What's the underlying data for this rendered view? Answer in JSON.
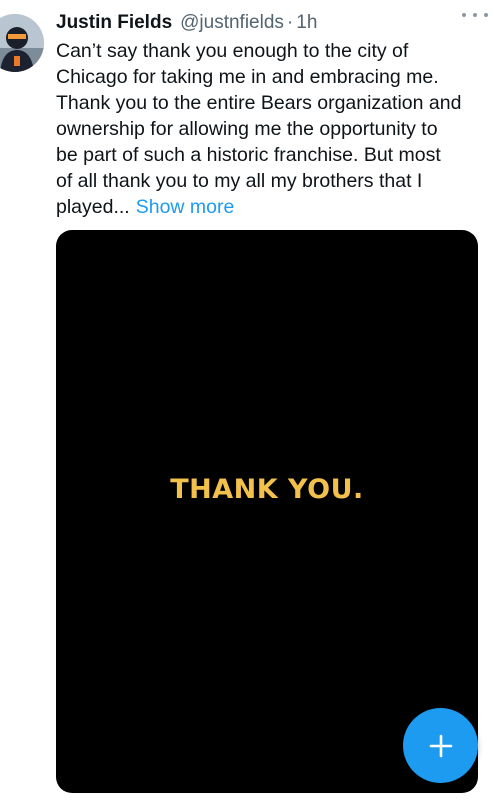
{
  "tweet": {
    "author_name": "Justin Fields",
    "handle": "@justnfields",
    "separator": "·",
    "time": "1h",
    "text_lines": [
      "Can’t say thank you enough to the city of",
      "Chicago for taking me in and embracing me.",
      "Thank you to the entire Bears organization and",
      "ownership for allowing me the opportunity to",
      "be part of such a historic franchise. But most",
      "of all thank you to my all my brothers that I",
      "played..."
    ],
    "show_more": "Show more",
    "media_text": "THANK YOU."
  },
  "icons": {
    "more": "more-horizontal-icon",
    "compose": "plus-icon"
  },
  "colors": {
    "accent": "#1d9bf0",
    "media_text": "#f2c14b",
    "secondary_text": "#536471"
  }
}
